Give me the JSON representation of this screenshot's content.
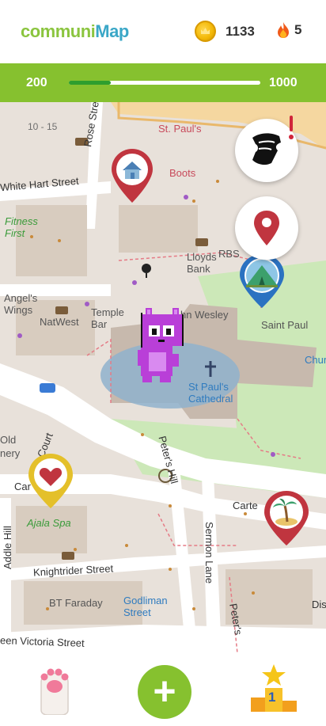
{
  "app": {
    "logo_part1": "communi",
    "logo_part2": "Map"
  },
  "header": {
    "coins": "1133",
    "streak": "5"
  },
  "progress": {
    "min_label": "200",
    "max_label": "1000",
    "fraction": 0.22
  },
  "map": {
    "labels": {
      "st_pauls": "St. Paul's",
      "boots": "Boots",
      "range": "10 - 15",
      "rose_street": "Rose Street",
      "white_hart": "White Hart Street",
      "fitness_first": "Fitness\nFirst",
      "lloyds": "Lloyds\nBank",
      "rbs": "RBS",
      "angels_wings": "Angel's\nWings",
      "natwest": "NatWest",
      "temple_bar": "Temple\nBar",
      "john_wesley": "hn Wesley",
      "saint_paul": "Saint Paul",
      "chur": "Chur",
      "cathedral": "St Paul's\nCathedral",
      "old": "Old",
      "nery": "nery",
      "court": "Court",
      "car": "Car",
      "peters_hill": "Peter's Hill",
      "carte": "Carte",
      "ajala": "Ajala Spa",
      "addle_hill": "Addle Hill",
      "sermon_lane": "Sermon Lane",
      "knightrider": "Knightrider Street",
      "bt_faraday": "BT Faraday",
      "godliman": "Godliman\nStreet",
      "dis": "Dis",
      "peters_hill2": "Peter's",
      "victoria": "een Victoria Street"
    }
  },
  "bottom_nav": {
    "add_label": "+",
    "rank_number": "1"
  },
  "colors": {
    "brand_green": "#86c12f",
    "brand_blue": "#3aa7c7",
    "pin_red": "#c0353f",
    "pin_blue": "#2b72c1",
    "pin_yellow": "#e4c02a"
  }
}
